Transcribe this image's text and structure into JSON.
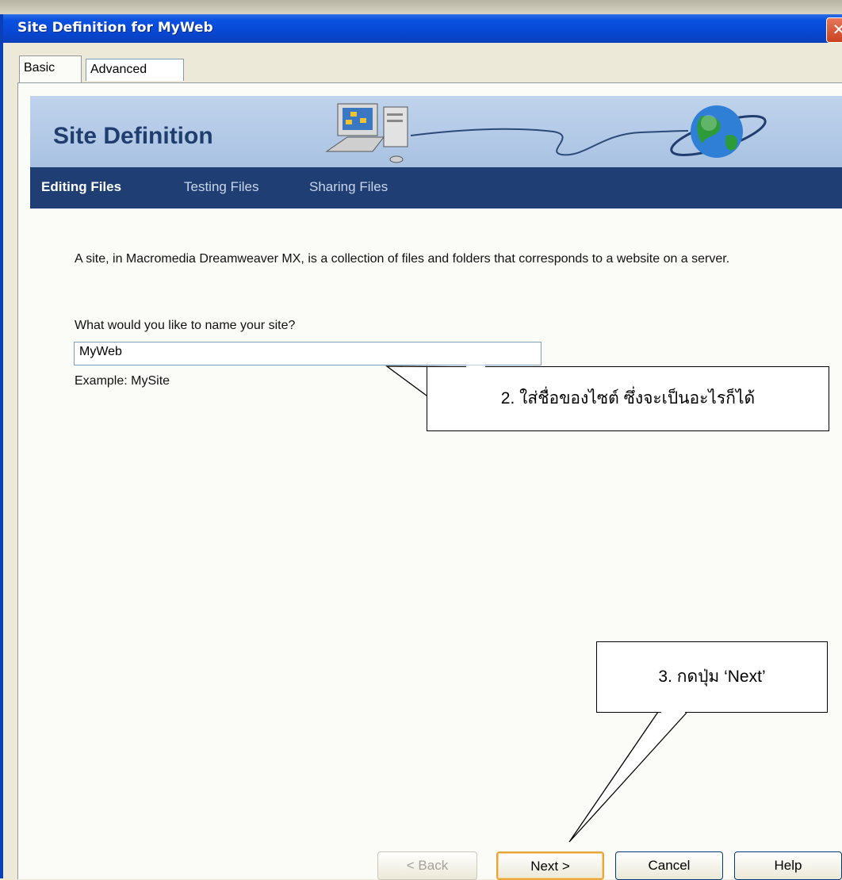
{
  "window": {
    "title": "Site Definition for MyWeb",
    "close_glyph": "✕"
  },
  "tabs": [
    {
      "label": "Basic",
      "active": true
    },
    {
      "label": "Advanced",
      "active": false
    }
  ],
  "banner": {
    "title": "Site Definition",
    "icons": [
      "computer-icon",
      "globe-icon"
    ]
  },
  "subnav": [
    {
      "label": "Editing Files",
      "active": true
    },
    {
      "label": "Testing Files",
      "active": false
    },
    {
      "label": "Sharing Files",
      "active": false
    }
  ],
  "content": {
    "description": "A site, in Macromedia Dreamweaver MX, is a collection of files and folders that corresponds to a website on a server.",
    "question": "What would you like to name your site?",
    "site_name_value": "MyWeb",
    "example": "Example: MySite"
  },
  "callouts": {
    "step2": "2. ใส่ชื่อของไซต์ ซึ่งจะเป็นอะไรก็ได้",
    "step3": "3.  กดปุ่ม ‘Next’"
  },
  "buttons": {
    "back": "< Back",
    "next": "Next >",
    "cancel": "Cancel",
    "help": "Help"
  },
  "colors": {
    "titlebar": "#0a52e0",
    "banner": "#b7cbe8",
    "subnav": "#1f3f74",
    "next_focus": "#e7a63a"
  }
}
